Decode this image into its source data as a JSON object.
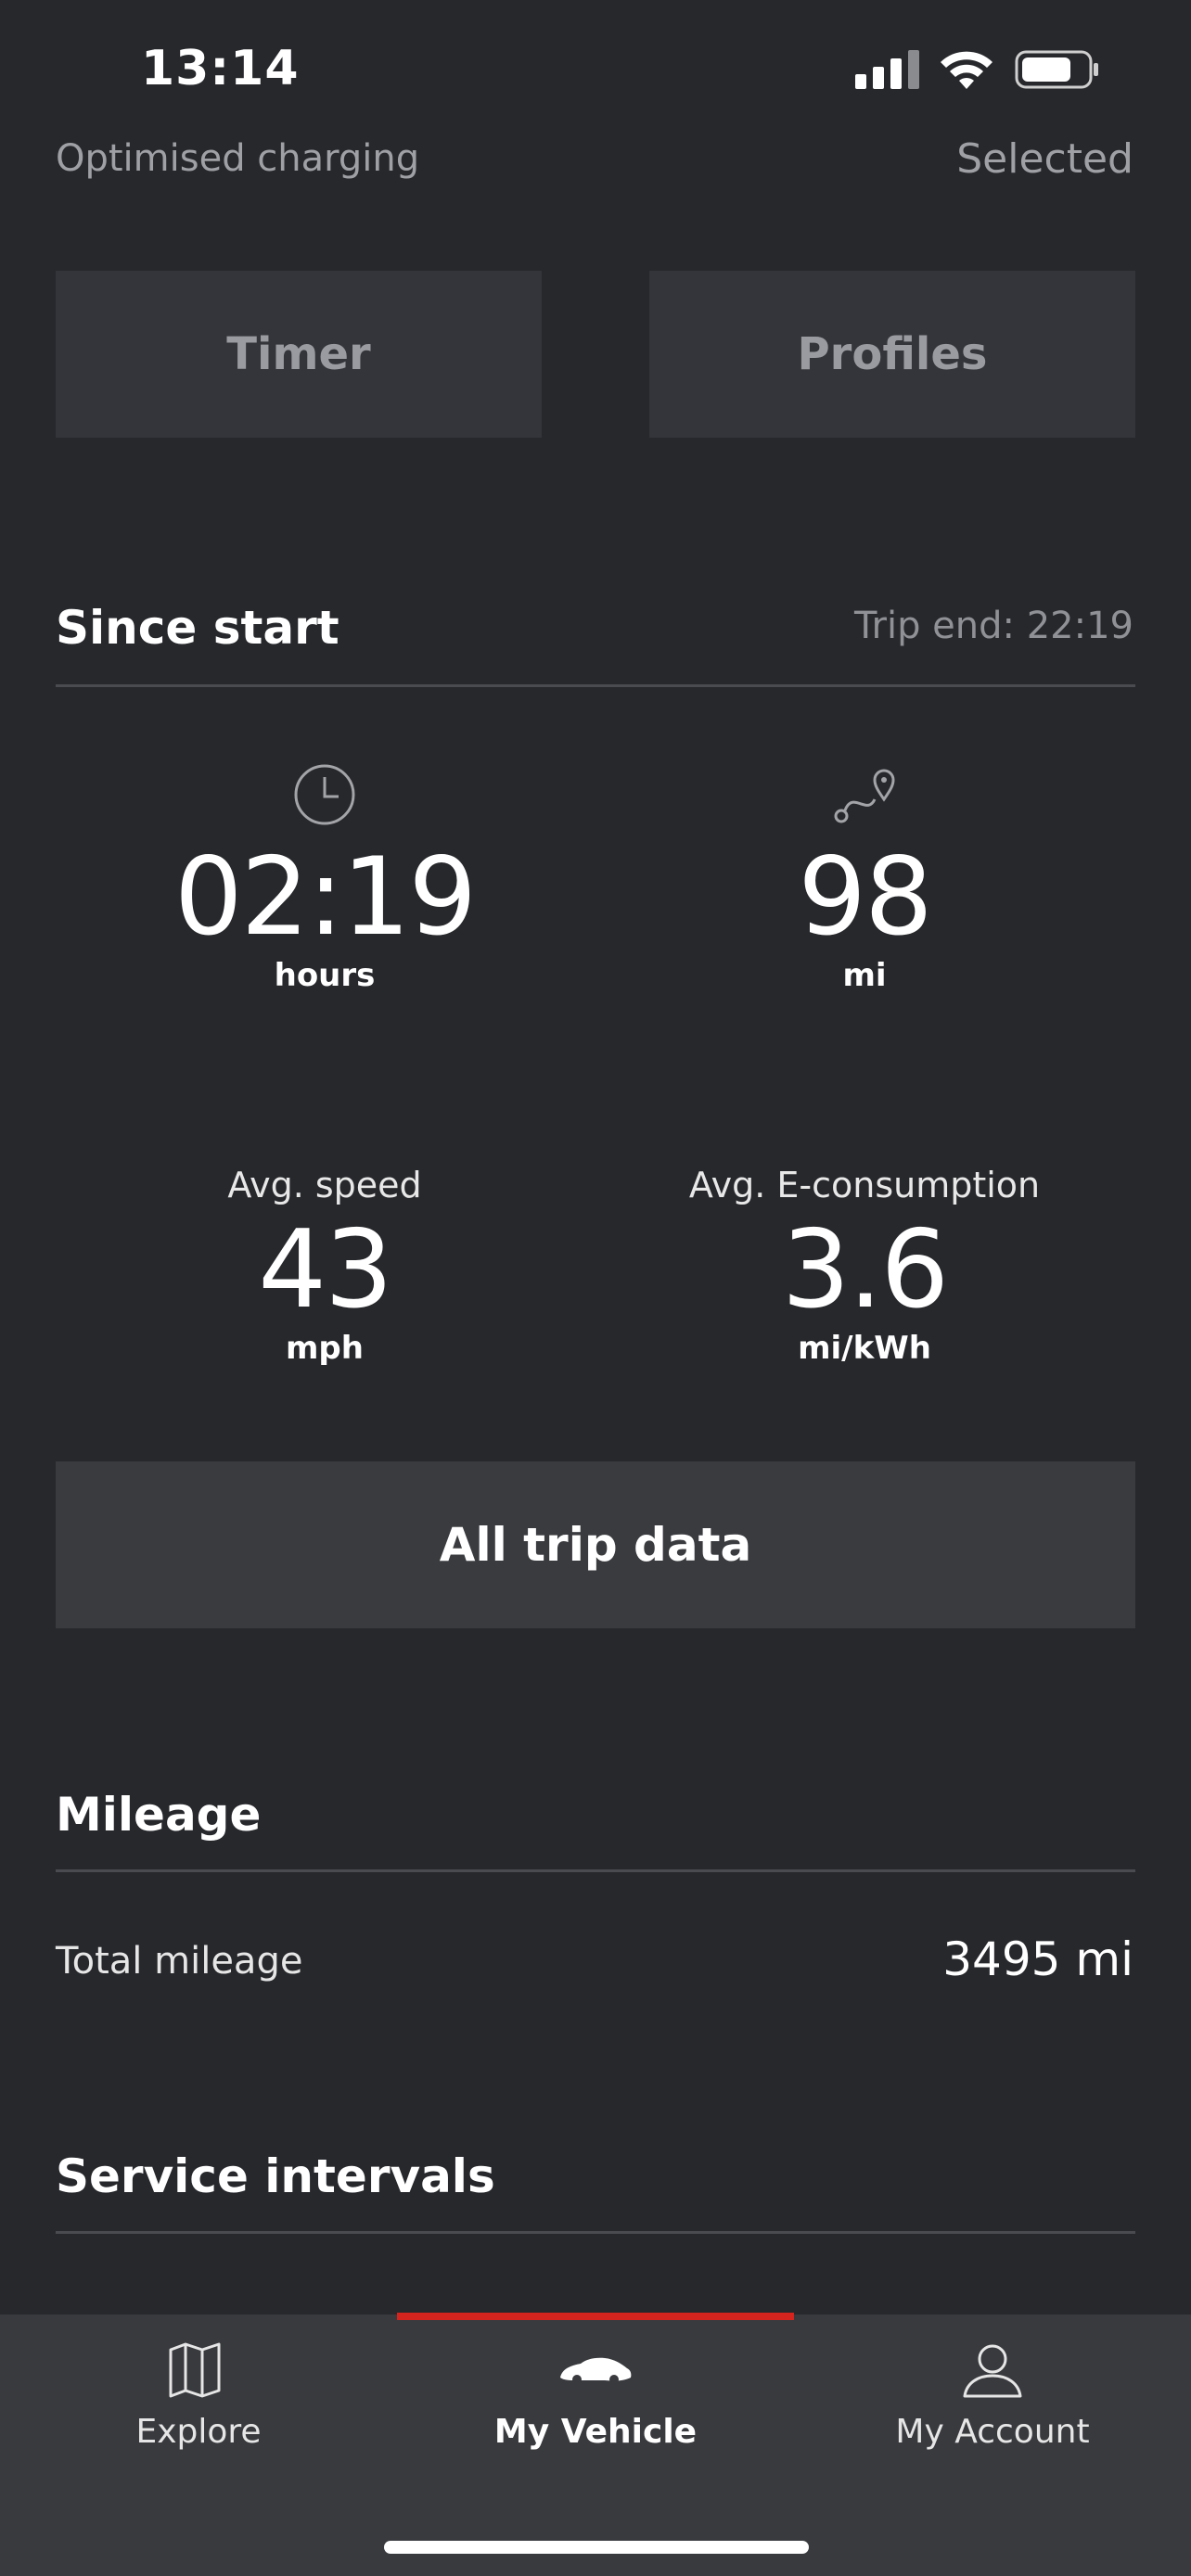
{
  "status_bar": {
    "time": "13:14"
  },
  "charging": {
    "label": "Optimised charging",
    "value": "Selected"
  },
  "buttons": {
    "timer": "Timer",
    "profiles": "Profiles"
  },
  "since_start": {
    "title": "Since start",
    "trip_end": "Trip end: 22:19",
    "duration_value": "02:19",
    "duration_unit": "hours",
    "distance_value": "98",
    "distance_unit": "mi",
    "avg_speed_label": "Avg. speed",
    "avg_speed_value": "43",
    "avg_speed_unit": "mph",
    "avg_consumption_label": "Avg. E-consumption",
    "avg_consumption_value": "3.6",
    "avg_consumption_unit": "mi/kWh",
    "all_trip_button": "All trip data"
  },
  "mileage": {
    "title": "Mileage",
    "total_label": "Total mileage",
    "total_value": "3495 mi"
  },
  "service": {
    "title": "Service intervals"
  },
  "tabbar": {
    "explore": "Explore",
    "my_vehicle": "My Vehicle",
    "my_account": "My Account",
    "active_color": "#d5231e"
  },
  "icons": {
    "duration": "clock-icon",
    "distance": "route-icon",
    "explore": "map-icon",
    "vehicle": "car-icon",
    "account": "person-icon"
  }
}
